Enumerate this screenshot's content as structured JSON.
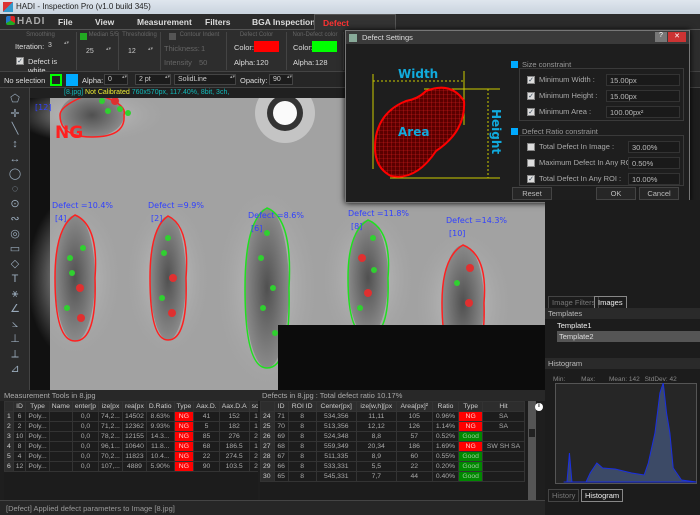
{
  "window": {
    "title": "HADI - Inspection Pro (v1.0 build 345)"
  },
  "menu": {
    "logo": "HADI",
    "items": [
      "File",
      "View",
      "Measurement",
      "Filters",
      "BGA Inspection",
      "Defect Inspection"
    ],
    "active": "Defect Inspection"
  },
  "ribbon": {
    "smoothing": {
      "title": "Smoothing",
      "iteration_label": "Iteration:",
      "iteration": "3",
      "defect_white_label": "Defect is white",
      "defect_white": true
    },
    "median": {
      "title": "Median 5/5",
      "value": "25"
    },
    "thresholding": {
      "title": "Thresholding",
      "value": "12"
    },
    "contour": {
      "title": "Contour Indent",
      "thickness_label": "Thickness:",
      "thickness": "1",
      "intensity_label": "Intensity",
      "intensity": "50"
    },
    "defect_color": {
      "title": "Defect Color",
      "color_label": "Color:",
      "color": "#ff0000",
      "alpha_label": "Alpha:",
      "alpha": "120"
    },
    "nondefect_color": {
      "title": "Non-Defect color",
      "color_label": "Color:",
      "color": "#00ff00",
      "alpha_label": "Alpha:",
      "alpha": "128"
    }
  },
  "toolbar": {
    "selection": "No selection",
    "stroke_color": "#00ff00",
    "fill_color": "#00aaff",
    "alpha_label": "Alpha:",
    "alpha": "0",
    "width": "2 pt",
    "line_style": "SolidLine",
    "opacity_label": "Opacity:",
    "opacity": "90"
  },
  "image": {
    "filename": "[8.jpg]",
    "calibration": "Not Calibrated",
    "info": "760x570px, 117.40%, 8bit, 3ch,",
    "ng_label": "NG",
    "pads": [
      {
        "id": "[12]",
        "defect": "",
        "status": "NG"
      },
      {
        "id": "[4]",
        "defect": "Defect =10.4%",
        "status": "NG"
      },
      {
        "id": "[2]",
        "defect": "Defect =9.9%",
        "status": "NG"
      },
      {
        "id": "[6]",
        "defect": "Defect =8.6%",
        "status": "OK"
      },
      {
        "id": "[8]",
        "defect": "Defect =11.8%",
        "status": "OK"
      },
      {
        "id": "[10]",
        "defect": "Defect =14.3%",
        "status": "NG"
      }
    ],
    "ng_color": "#ff2020",
    "ok_color": "#20e020",
    "label_color": "#3040ff"
  },
  "dialog": {
    "title": "Defect Settings",
    "diagram": {
      "width": "Width",
      "height": "Height",
      "area": "Area"
    },
    "size_constraint": {
      "title": "Size constraint",
      "rows": [
        {
          "label": "Minimum Width :",
          "checked": true,
          "value": "15.00px"
        },
        {
          "label": "Minimum Height :",
          "checked": true,
          "value": "15.00px"
        },
        {
          "label": "Minimum Area :",
          "checked": true,
          "value": "100.00px²"
        }
      ]
    },
    "ratio_constraint": {
      "title": "Defect Ratio constraint",
      "rows": [
        {
          "label": "Total Defect In Image :",
          "checked": false,
          "value": "30.00%"
        },
        {
          "label": "Maximum Defect In Any ROI :",
          "checked": false,
          "value": "0.50%"
        },
        {
          "label": "Total Defect In Any ROI :",
          "checked": true,
          "value": "10.00%"
        }
      ]
    },
    "reset": "Reset",
    "ok": "OK",
    "cancel": "Cancel"
  },
  "right_panel": {
    "tabs": [
      "Image Filters",
      "Images"
    ],
    "active_tab": "Images",
    "templates_title": "Templates",
    "templates": [
      "Template1",
      "Template2"
    ],
    "selected_template": "Template2",
    "histogram_title": "Histogram",
    "histogram": {
      "min_label": "Min:",
      "min": "",
      "max_label": "Max:",
      "max": "",
      "mean_label": "Mean:",
      "mean": "142",
      "std_label": "StdDev:",
      "std": "42"
    },
    "bottom_tabs": [
      "History",
      "Histogram"
    ],
    "active_bottom_tab": "Histogram"
  },
  "measurement": {
    "title": "Measurement Tools in 8.jpg",
    "headers": [
      "",
      "ID",
      "Type",
      "Name",
      "enter[p",
      "ize[px",
      "rea[px",
      "D.Ratio",
      "Type",
      "Aax.D.",
      "Aax.D.A",
      "sc.D.Ra"
    ],
    "rows": [
      [
        "1",
        "6",
        "Poly...",
        "",
        "0,0",
        "74,2...",
        "14502",
        "8.63%",
        "NG",
        "41",
        "152",
        "1.01%"
      ],
      [
        "2",
        "2",
        "Poly...",
        "",
        "0,0",
        "71,2...",
        "12362",
        "9.93%",
        "NG",
        "5",
        "182",
        "1.43%"
      ],
      [
        "3",
        "10",
        "Poly...",
        "",
        "0,0",
        "78,2...",
        "12155",
        "14.3...",
        "NG",
        "85",
        "276",
        "2.19%"
      ],
      [
        "4",
        "8",
        "Poly...",
        "",
        "0,0",
        "96,1...",
        "10640",
        "11.8...",
        "NG",
        "68",
        "186.5",
        "1.69%"
      ],
      [
        "5",
        "4",
        "Poly...",
        "",
        "0,0",
        "70,2...",
        "11823",
        "10.4...",
        "NG",
        "22",
        "274.5",
        "2.25%"
      ],
      [
        "6",
        "12",
        "Poly...",
        "",
        "0,0",
        "107,...",
        "4889",
        "5.90%",
        "NG",
        "90",
        "103.5",
        "2.04%"
      ]
    ]
  },
  "defects": {
    "title": "Defects in 8.jpg : Total defect ratio 10.17%",
    "headers": [
      "",
      "ID",
      "ROI ID",
      "Center[px]",
      "ize[w,h][px",
      "Area[px]²",
      "Ratio",
      "Type",
      "Hit"
    ],
    "rows": [
      [
        "24",
        "71",
        "8",
        "534,356",
        "11,11",
        "105",
        "0.96%",
        "NG",
        "SA"
      ],
      [
        "25",
        "70",
        "8",
        "513,356",
        "12,12",
        "126",
        "1.14%",
        "NG",
        "SA"
      ],
      [
        "26",
        "69",
        "8",
        "524,348",
        "8,8",
        "57",
        "0.52%",
        "Good",
        ""
      ],
      [
        "27",
        "68",
        "8",
        "559,349",
        "20,34",
        "186",
        "1.69%",
        "NG",
        "SW SH SA"
      ],
      [
        "28",
        "67",
        "8",
        "511,335",
        "8,9",
        "60",
        "0.55%",
        "Good",
        ""
      ],
      [
        "29",
        "66",
        "8",
        "533,331",
        "5,5",
        "22",
        "0.20%",
        "Good",
        ""
      ],
      [
        "30",
        "65",
        "8",
        "545,331",
        "7,7",
        "44",
        "0.40%",
        "Good",
        ""
      ]
    ]
  },
  "status": {
    "message": "[Defect] Applied defect parameters to Image [8.jpg]"
  }
}
